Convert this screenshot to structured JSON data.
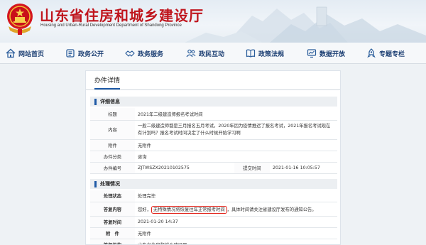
{
  "header": {
    "title": "山东省住房和城乡建设厅",
    "subtitle": "Housing and Urban-Rural Development Department of Shandong Province"
  },
  "nav": [
    {
      "label": "网站首页",
      "icon": "home-icon"
    },
    {
      "label": "政务公开",
      "icon": "building-icon"
    },
    {
      "label": "政务服务",
      "icon": "handshake-icon"
    },
    {
      "label": "政民互动",
      "icon": "people-icon"
    },
    {
      "label": "政策法规",
      "icon": "book-icon"
    },
    {
      "label": "数据开放",
      "icon": "chart-icon"
    },
    {
      "label": "专题专栏",
      "icon": "rocket-icon"
    }
  ],
  "panel": {
    "title": "办件详情",
    "details": {
      "heading": "详细信息",
      "title_label": "标题",
      "title_value": "2021年二级建造师报名考试时间",
      "content_label": "内容",
      "content_value": "一般二级建造师都是三月报名五月考试，2020年因为疫情推迟了报名考试，2021年报名考试现在有计划吗？报名考试时间决定了什么时候开始学习啊",
      "attachment_label": "附件",
      "attachment_value": "无附件",
      "category_label": "办件分类",
      "category_value": "咨询",
      "number_label": "办件编号",
      "number_value": "ZJTWSZX20210102575",
      "submit_time_label": "提交时间",
      "submit_time_value": "2021-01-16 10:05:57"
    },
    "processing": {
      "heading": "处理情况",
      "status_label": "处理状态",
      "status_value": "处理完毕",
      "reply_label": "答复内容",
      "reply_prefix": "您好，",
      "reply_highlight": "无特殊情况将恢复往年正常报考时间",
      "reply_suffix": "，具体时间请关注省建设厅发布的通知公告。",
      "reply_time_label": "答复时间",
      "reply_time_value": "2021-01-20 14:37",
      "attachment_label": "附　件",
      "attachment_value": "无附件",
      "agency_label": "答复机构",
      "agency_value": "山东省住房和城乡建设厅"
    }
  }
}
